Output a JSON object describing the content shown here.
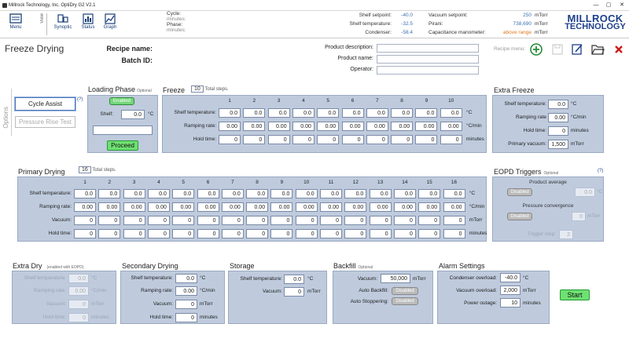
{
  "window": {
    "title": "Millrock Technology, Inc.   OptiDry G2 V2.1",
    "min": "—",
    "max": "▢",
    "close": "✕"
  },
  "toolbar": {
    "menu": "Menu",
    "view": "View",
    "synoptic": "Synoptic",
    "status": "Status",
    "graph": "Graph"
  },
  "cycle": {
    "cycle_label": "Cycle:",
    "cycle_val": "minutes:",
    "phase_label": "Phase:",
    "phase_val": "minutes:"
  },
  "readouts": {
    "shelf_setpoint": {
      "label": "Shelf setpoint:",
      "value": "-40.0"
    },
    "shelf_temp": {
      "label": "Shelf temperature:",
      "value": "-32.5"
    },
    "condenser": {
      "label": "Condenser:",
      "value": "-58.4"
    },
    "vacuum_setpoint": {
      "label": "Vacuum setpoint:",
      "value": "250",
      "unit": "mTorr"
    },
    "pirani": {
      "label": "Pirani:",
      "value": "738,690",
      "unit": "mTorr"
    },
    "capacitance": {
      "label": "Capacitance manometer:",
      "value": "above range",
      "unit": "mTorr"
    }
  },
  "logo": {
    "line1": "MILLROCK",
    "line2": "TECHNOLOGY"
  },
  "page": {
    "title": "Freeze Drying",
    "recipe_name": "Recipe name:",
    "batch_id": "Batch ID:",
    "product_description": "Product description:",
    "product_name": "Product name:",
    "operator": "Operator:",
    "recipe_menu": "Recipe menu:"
  },
  "options": {
    "label": "Options",
    "cycle_assist": "Cycle Assist",
    "help": "(?)",
    "pressure_rise": "Pressure Rise Test"
  },
  "loading": {
    "title": "Loading Phase",
    "optional": "Optional",
    "status": "Enabled",
    "shelf_label": "Shelf:",
    "shelf_value": "0.0",
    "shelf_unit": "°C",
    "proceed": "Proceed"
  },
  "freeze": {
    "title": "Freeze",
    "steps": "10",
    "steps_label": "Total steps.",
    "cols": [
      "1",
      "2",
      "3",
      "4",
      "5",
      "6",
      "7",
      "8",
      "9",
      "10"
    ],
    "rows": [
      {
        "label": "Shelf temperature:",
        "unit": "°C",
        "values": [
          "0.0",
          "0.0",
          "0.0",
          "0.0",
          "0.0",
          "0.0",
          "0.0",
          "0.0",
          "0.0",
          "0.0"
        ]
      },
      {
        "label": "Ramping rate:",
        "unit": "°C/min",
        "values": [
          "0.00",
          "0.00",
          "0.00",
          "0.00",
          "0.00",
          "0.00",
          "0.00",
          "0.00",
          "0.00",
          "0.00"
        ]
      },
      {
        "label": "Hold time:",
        "unit": "minutes",
        "values": [
          "0",
          "0",
          "0",
          "0",
          "0",
          "0",
          "0",
          "0",
          "0",
          "0"
        ]
      }
    ]
  },
  "extra_freeze": {
    "title": "Extra Freeze",
    "shelf_label": "Shelf temperature:",
    "shelf_value": "0.0",
    "shelf_unit": "°C",
    "ramp_label": "Ramping rate",
    "ramp_value": "0.00",
    "ramp_unit": "°C/min",
    "hold_label": "Hold time:",
    "hold_value": "0",
    "hold_unit": "minutes",
    "vac_label": "Primary vacuum:",
    "vac_value": "1,500",
    "vac_unit": "mTorr"
  },
  "primary": {
    "title": "Primary Drying",
    "steps": "16",
    "steps_label": "Total steps.",
    "cols": [
      "1",
      "2",
      "3",
      "4",
      "5",
      "6",
      "7",
      "8",
      "9",
      "10",
      "11",
      "12",
      "13",
      "14",
      "15",
      "16"
    ],
    "rows": [
      {
        "label": "Shelf temperature:",
        "unit": "°C",
        "values": [
          "0.0",
          "0.0",
          "0.0",
          "0.0",
          "0.0",
          "0.0",
          "0.0",
          "0.0",
          "0.0",
          "0.0",
          "0.0",
          "0.0",
          "0.0",
          "0.0",
          "0.0",
          "0.0"
        ]
      },
      {
        "label": "Ramping rate:",
        "unit": "°C/min",
        "values": [
          "0.00",
          "0.00",
          "0.00",
          "0.00",
          "0.00",
          "0.00",
          "0.00",
          "0.00",
          "0.00",
          "0.00",
          "0.00",
          "0.00",
          "0.00",
          "0.00",
          "0.00",
          "0.00"
        ]
      },
      {
        "label": "Vacuum:",
        "unit": "mTorr",
        "values": [
          "0",
          "0",
          "0",
          "0",
          "0",
          "0",
          "0",
          "0",
          "0",
          "0",
          "0",
          "0",
          "0",
          "0",
          "0",
          "0"
        ]
      },
      {
        "label": "Hold time:",
        "unit": "minutes",
        "values": [
          "0",
          "0",
          "0",
          "0",
          "0",
          "0",
          "0",
          "0",
          "0",
          "0",
          "0",
          "0",
          "0",
          "0",
          "0",
          "0"
        ]
      }
    ]
  },
  "eopd": {
    "title": "EOPD Triggers",
    "optional": "Optional",
    "help": "(?)",
    "avg_label": "Product average",
    "avg_status": "Disabled",
    "avg_value": "0.0",
    "avg_unit": "°C",
    "conv_label": "Pressure convergence",
    "conv_status": "Disabled",
    "conv_value": "0",
    "conv_unit": "mTorr",
    "trigger_label": "Trigger step:",
    "trigger_value": "2"
  },
  "extra_dry": {
    "title": "Extra Dry",
    "note": "(enabled with EOPD)",
    "shelf_label": "Shelf temperature:",
    "shelf_value": "0.0",
    "shelf_unit": "°C",
    "ramp_label": "Ramping rate:",
    "ramp_value": "0.00",
    "ramp_unit": "°C/min",
    "vac_label": "Vacuum:",
    "vac_value": "0",
    "vac_unit": "mTorr",
    "hold_label": "Hold time:",
    "hold_value": "0",
    "hold_unit": "minutes"
  },
  "secondary": {
    "title": "Secondary Drying",
    "shelf_label": "Shelf temperature:",
    "shelf_value": "0.0",
    "shelf_unit": "°C",
    "ramp_label": "Ramping rate:",
    "ramp_value": "0.00",
    "ramp_unit": "°C/min",
    "vac_label": "Vacuum:",
    "vac_value": "0",
    "vac_unit": "mTorr",
    "hold_label": "Hold time:",
    "hold_value": "0",
    "hold_unit": "minutes"
  },
  "storage": {
    "title": "Storage",
    "shelf_label": "Shelf temperature:",
    "shelf_value": "0.0",
    "shelf_unit": "°C",
    "vac_label": "Vacuum:",
    "vac_value": "0",
    "vac_unit": "mTorr"
  },
  "backfill": {
    "title": "Backfill",
    "optional": "Optional",
    "vac_label": "Vacuum:",
    "vac_value": "50,000",
    "vac_unit": "mTorr",
    "auto_backfill_label": "Auto Backfill:",
    "auto_backfill": "Disabled",
    "auto_stop_label": "Auto Stoppering:",
    "auto_stop": "Disabled"
  },
  "alarm": {
    "title": "Alarm Settings",
    "cond_label": "Condenser overload:",
    "cond_value": "-40.0",
    "cond_unit": "°C",
    "vac_label": "Vacuum overload:",
    "vac_value": "2,000",
    "vac_unit": "mTorr",
    "power_label": "Power outage:",
    "power_value": "10",
    "power_unit": "minutes"
  },
  "start": "Start",
  "colors": {
    "panel": "#bfcbdd",
    "accent": "#1d3f8a",
    "green": "#6fe072",
    "warn": "#e0781c"
  }
}
